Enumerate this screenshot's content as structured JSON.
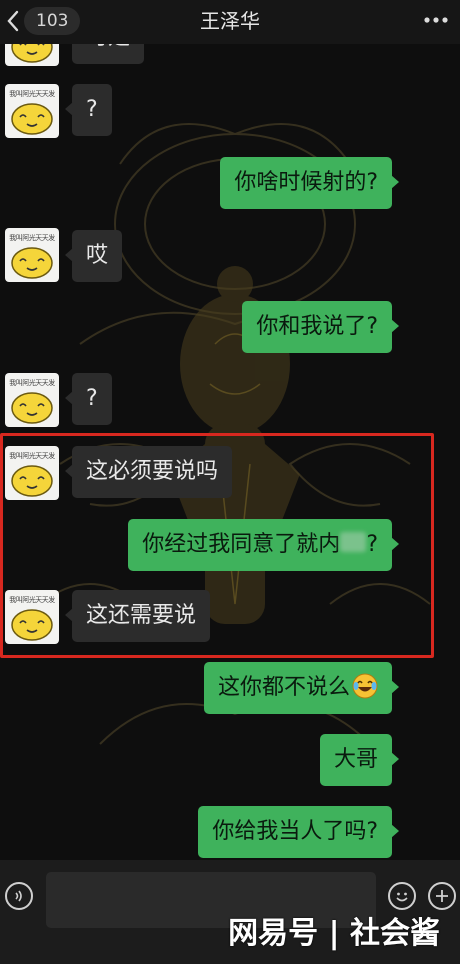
{
  "header": {
    "back_icon": "chevron-left-icon",
    "unread_count": "103",
    "title": "王泽华",
    "more_icon": "ellipsis-icon"
  },
  "avatar_caption": "我叫阿光天天发",
  "messages": [
    {
      "side": "in",
      "text": "可是"
    },
    {
      "side": "in",
      "text": "?"
    },
    {
      "side": "out",
      "text": "你啥时候射的?"
    },
    {
      "side": "in",
      "text": "哎"
    },
    {
      "side": "out",
      "text": "你和我说了?"
    },
    {
      "side": "in",
      "text": "?"
    },
    {
      "side": "in",
      "text": "这必须要说吗"
    },
    {
      "side": "out",
      "text_before": "你经过我同意了就内",
      "text_after": "?"
    },
    {
      "side": "in",
      "text": "这还需要说"
    },
    {
      "side": "out",
      "text": "这你都不说么",
      "emoji": "laughing-crying-emoji"
    },
    {
      "side": "out",
      "text": "大哥"
    },
    {
      "side": "out",
      "text": "你给我当人了吗?"
    }
  ],
  "input_bar": {
    "voice_icon": "voice-icon",
    "emoji_icon": "smiley-icon",
    "plus_icon": "plus-icon"
  },
  "watermark": "网易号 | 社会酱",
  "colors": {
    "background": "#0e0e0e",
    "incoming_bubble": "#2c2c2c",
    "outgoing_bubble": "#3fb25c",
    "highlight": "#d8281f"
  }
}
